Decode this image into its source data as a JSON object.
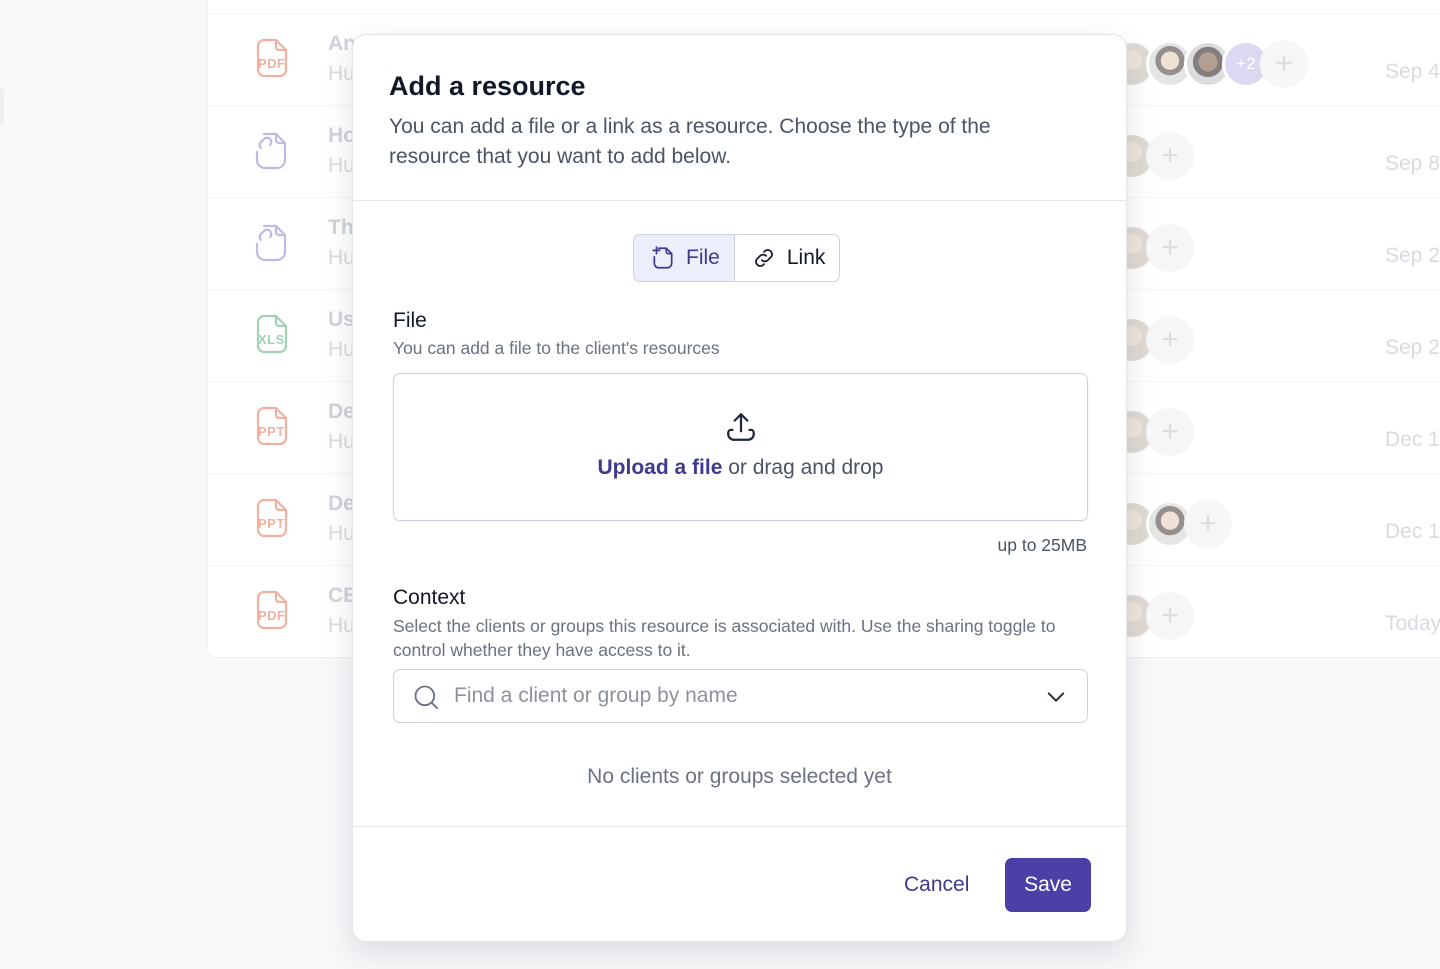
{
  "colors": {
    "accent": "#4b40a6",
    "accent_text": "#3e3a8f",
    "pdf": "#e9876e",
    "ppt": "#e9876e",
    "xls": "#6dbb8a",
    "link_file": "#9d95d6"
  },
  "background": {
    "rows": [
      {
        "icon": "pdf-file-icon",
        "type": "PDF",
        "name": "An",
        "sub": "Hu",
        "avatars": 3,
        "more": "+2",
        "date": "Sep 4"
      },
      {
        "icon": "link-file-icon",
        "type": "",
        "name": "Ho",
        "sub": "Hu",
        "avatars": 1,
        "more": "",
        "date": "Sep 8"
      },
      {
        "icon": "link-file-icon",
        "type": "",
        "name": "Th",
        "sub": "Hu",
        "avatars": 1,
        "more": "",
        "date": "Sep 2"
      },
      {
        "icon": "xls-file-icon",
        "type": "XLS",
        "name": "Us",
        "sub": "Hu",
        "avatars": 1,
        "more": "",
        "date": "Sep 2"
      },
      {
        "icon": "ppt-file-icon",
        "type": "PPT",
        "name": "De",
        "sub": "Hu",
        "avatars": 1,
        "more": "",
        "date": "Dec 1"
      },
      {
        "icon": "ppt-file-icon",
        "type": "PPT",
        "name": "De",
        "sub": "Hu",
        "avatars": 2,
        "more": "",
        "date": "Dec 1"
      },
      {
        "icon": "pdf-file-icon",
        "type": "PDF",
        "name": "CE",
        "sub": "Hu",
        "avatars": 1,
        "more": "",
        "date": "Today"
      }
    ]
  },
  "modal": {
    "title": "Add a resource",
    "description": "You can add a file or a link as a resource. Choose the type of the resource that you want to add below.",
    "type_toggle": {
      "options": [
        {
          "label": "File",
          "icon": "file-add-icon",
          "selected": true
        },
        {
          "label": "Link",
          "icon": "link-icon",
          "selected": false
        }
      ]
    },
    "file_section": {
      "label": "File",
      "help": "You can add a file to the client's resources",
      "upload_link": "Upload a file",
      "upload_rest": " or drag and drop",
      "limit": "up to 25MB"
    },
    "context_section": {
      "label": "Context",
      "help": "Select the clients or groups this resource is associated with. Use the sharing toggle to control whether they have access to it.",
      "search_placeholder": "Find a client or group by name",
      "empty_text": "No clients or groups selected yet"
    },
    "footer": {
      "cancel_label": "Cancel",
      "save_label": "Save"
    }
  }
}
